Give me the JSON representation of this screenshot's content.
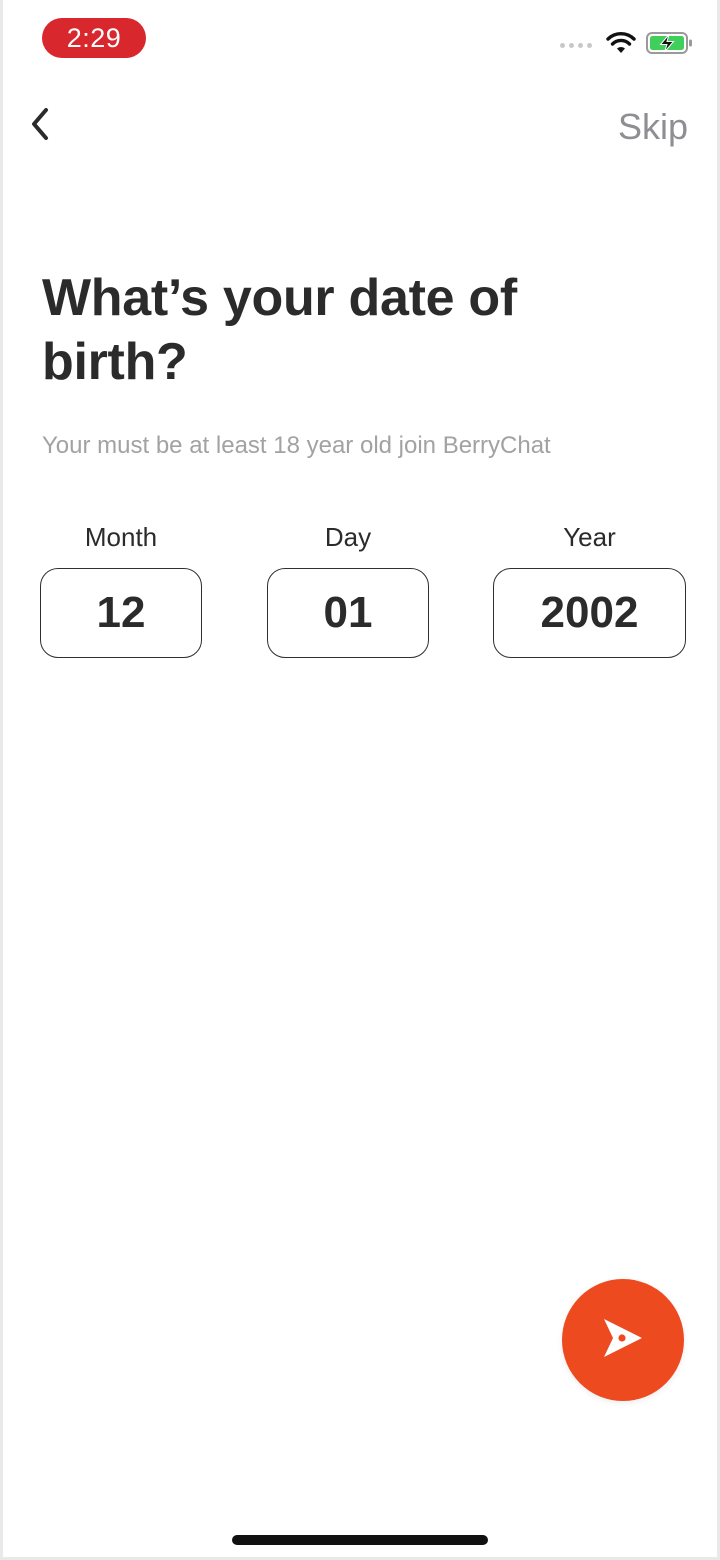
{
  "status_bar": {
    "time": "2:29",
    "icons": [
      "cellular-dots-icon",
      "wifi-icon",
      "battery-charging-icon"
    ],
    "time_pill_color": "#d9272e"
  },
  "nav": {
    "back_icon": "chevron-left-icon",
    "skip_label": "Skip"
  },
  "page": {
    "title": "What’s your date of birth?",
    "subtitle": "Your must be at least 18 year old join BerryChat"
  },
  "fields": {
    "month": {
      "label": "Month",
      "value": "12"
    },
    "day": {
      "label": "Day",
      "value": "01"
    },
    "year": {
      "label": "Year",
      "value": "2002"
    }
  },
  "next_button": {
    "icon": "send-arrow-icon",
    "color": "#ee4a1f"
  }
}
